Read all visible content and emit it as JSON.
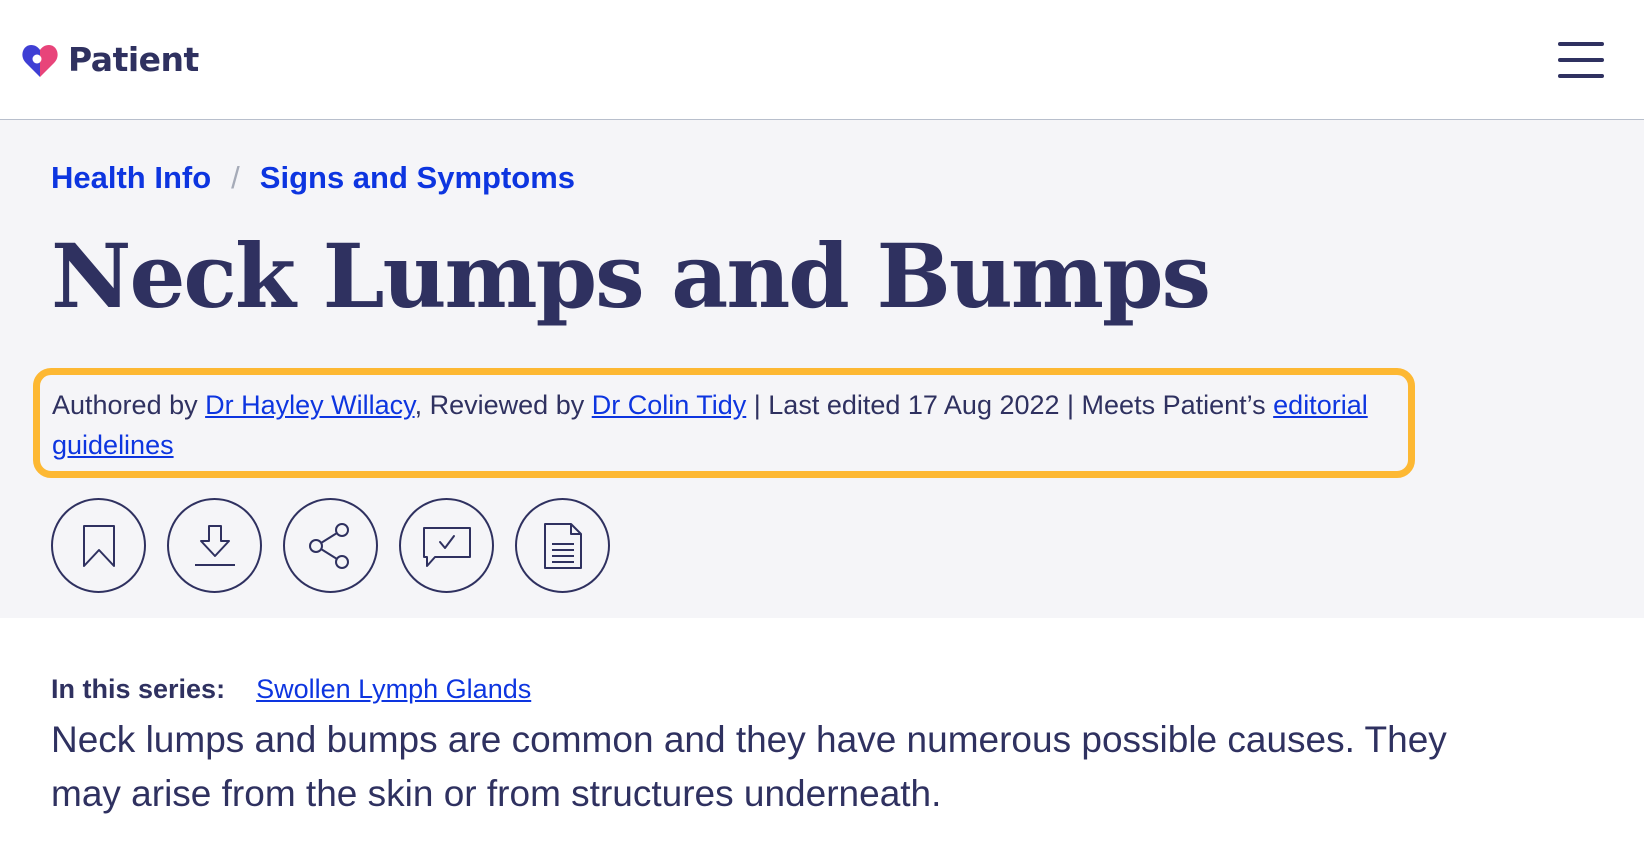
{
  "header": {
    "brand": "Patient",
    "logo_icon": "heart-pin-icon",
    "menu_icon": "hamburger-menu-icon",
    "brand_colors": [
      "#3f3fd4",
      "#e8447a"
    ]
  },
  "breadcrumb": {
    "items": [
      {
        "label": "Health Info"
      },
      {
        "label": "Signs and Symptoms"
      }
    ],
    "separator": "/"
  },
  "article": {
    "title": "Neck Lumps and Bumps",
    "byline": {
      "authored_prefix": "Authored by ",
      "author": "Dr Hayley Willacy",
      "reviewed_prefix": ", Reviewed by ",
      "reviewer": "Dr Colin Tidy",
      "edited_text": " | Last edited 17 Aug 2022 | Meets Patient’s ",
      "guidelines_link": "editorial guidelines"
    },
    "actions": [
      {
        "icon": "bookmark-icon"
      },
      {
        "icon": "download-icon"
      },
      {
        "icon": "share-icon"
      },
      {
        "icon": "feedback-icon"
      },
      {
        "icon": "document-icon"
      }
    ],
    "series_label": "In this series:",
    "series_link": "Swollen Lymph Glands",
    "intro": "Neck lumps and bumps are common and they have numerous possible causes. They may arise from the skin or from structures underneath."
  },
  "colors": {
    "link": "#0d35e0",
    "text": "#2f3160",
    "hero_bg": "#f5f5f8",
    "highlight_border": "#fdb833"
  }
}
